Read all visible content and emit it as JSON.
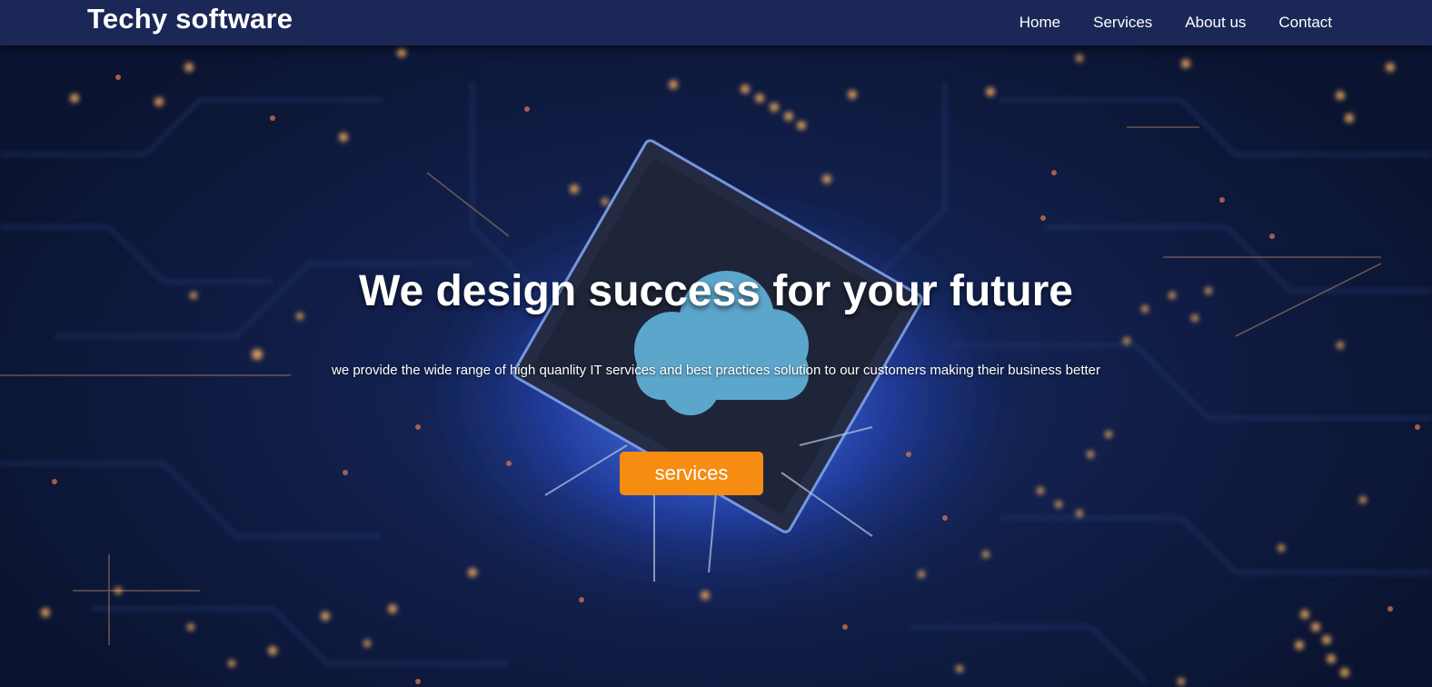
{
  "navbar": {
    "brand": "Techy software",
    "links": [
      "Home",
      "Services",
      "About us",
      "Contact"
    ]
  },
  "hero": {
    "title": "We design success for your future",
    "subtitle": "we provide the wide range of high quanlity IT services and best practices solution to our customers making their business better",
    "button_label": "services",
    "background_image": "circuit-board-chip-cloud-icon"
  },
  "colors": {
    "navbar_bg": "#1b2756",
    "button_bg": "#f68c12",
    "text": "#ffffff",
    "hero_glow": "#4678ff"
  }
}
